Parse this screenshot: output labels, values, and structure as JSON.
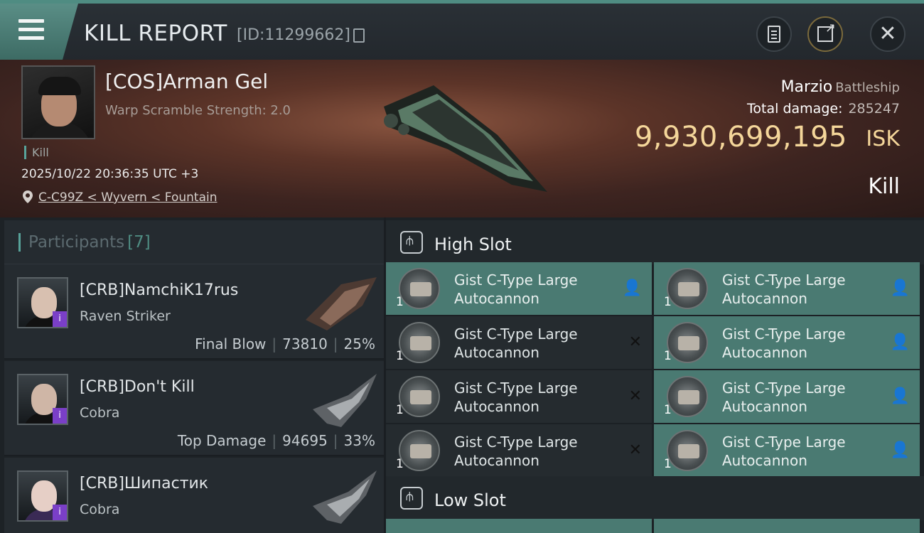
{
  "header": {
    "title": "KILL REPORT",
    "report_id": "[ID:11299662]"
  },
  "victim": {
    "name": "[COS]Arman Gel",
    "subtitle": "Warp Scramble Strength: 2.0",
    "tag": "Kill",
    "time": "2025/10/22 20:36:35 UTC +3",
    "location": "C-C99Z < Wyvern < Fountain",
    "ship_name": "Marzio",
    "ship_class": "Battleship",
    "total_damage_label": "Total damage:",
    "total_damage": "285247",
    "isk_value": "9,930,699,195",
    "isk_unit": "ISK",
    "kill_type": "Kill"
  },
  "participants": {
    "title": "Participants",
    "count": "[7]",
    "items": [
      {
        "name": "[CRB]NamchiK17rus",
        "ship": "Raven Striker",
        "role": "Final Blow",
        "damage": "73810",
        "percent": "25%"
      },
      {
        "name": "[CRB]Don't Kill",
        "ship": "Cobra",
        "role": "Top Damage",
        "damage": "94695",
        "percent": "33%"
      },
      {
        "name": "[CRB]Шипастик",
        "ship": "Cobra",
        "role": "",
        "damage": "",
        "percent": ""
      }
    ]
  },
  "slots": {
    "high_title": "High Slot",
    "low_title": "Low Slot",
    "modules": [
      {
        "line1": "Gist C-Type Large",
        "line2": "Autocannon",
        "qty": "1",
        "status": "person",
        "style": "green"
      },
      {
        "line1": "Gist C-Type Large",
        "line2": "Autocannon",
        "qty": "1",
        "status": "person",
        "style": "green"
      },
      {
        "line1": "Gist C-Type Large",
        "line2": "Autocannon",
        "qty": "1",
        "status": "destroyed",
        "style": "dark"
      },
      {
        "line1": "Gist C-Type Large",
        "line2": "Autocannon",
        "qty": "1",
        "status": "person",
        "style": "green"
      },
      {
        "line1": "Gist C-Type Large",
        "line2": "Autocannon",
        "qty": "1",
        "status": "destroyed",
        "style": "dark"
      },
      {
        "line1": "Gist C-Type Large",
        "line2": "Autocannon",
        "qty": "1",
        "status": "person",
        "style": "green"
      },
      {
        "line1": "Gist C-Type Large",
        "line2": "Autocannon",
        "qty": "1",
        "status": "destroyed",
        "style": "dark"
      },
      {
        "line1": "Gist C-Type Large",
        "line2": "Autocannon",
        "qty": "1",
        "status": "person",
        "style": "green"
      }
    ]
  },
  "colors": {
    "accent": "#4f8c82",
    "isk_gold": "#f4d69a",
    "badge_purple": "#7a3fc7"
  }
}
